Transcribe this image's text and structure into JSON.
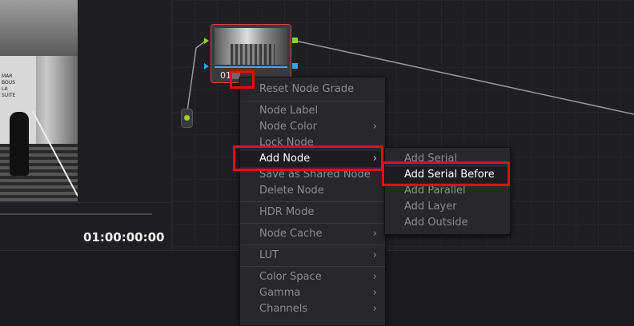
{
  "viewer": {
    "timecode": "01:00:00:00",
    "sign_text": "MAR\nBOUS\nLA\nSUITE"
  },
  "node": {
    "label": "01"
  },
  "context_menu": {
    "items": [
      {
        "label": "Reset Node Grade",
        "submenu": false
      },
      {
        "label": "Node Label",
        "submenu": false
      },
      {
        "label": "Node Color",
        "submenu": true
      },
      {
        "label": "Lock Node",
        "submenu": false
      },
      {
        "label": "Add Node",
        "submenu": true,
        "active": true
      },
      {
        "label": "Save as Shared Node",
        "submenu": false
      },
      {
        "label": "Delete Node",
        "submenu": false
      },
      {
        "label": "HDR Mode",
        "submenu": false
      },
      {
        "label": "Node Cache",
        "submenu": true
      },
      {
        "label": "LUT",
        "submenu": true
      },
      {
        "label": "Color Space",
        "submenu": true
      },
      {
        "label": "Gamma",
        "submenu": true
      },
      {
        "label": "Channels",
        "submenu": true
      }
    ],
    "arrow_glyph": "›"
  },
  "submenu": {
    "items": [
      {
        "label": "Add Serial"
      },
      {
        "label": "Add Serial Before",
        "active": true
      },
      {
        "label": "Add Parallel"
      },
      {
        "label": "Add Layer"
      },
      {
        "label": "Add Outside"
      }
    ]
  },
  "colors": {
    "highlight_red": "#e01010",
    "port_green": "#8bd12b",
    "port_blue": "#36a0e0"
  }
}
